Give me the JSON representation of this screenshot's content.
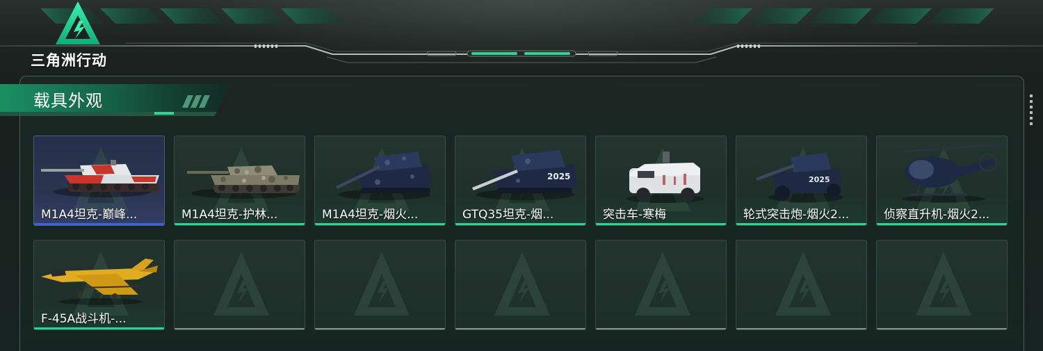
{
  "app": {
    "logo_text": "三角洲行动",
    "accent_color": "#2fd495",
    "selected_color": "#3a64e0"
  },
  "section": {
    "title": "载具外观"
  },
  "items": [
    {
      "label": "M1A4坦克-巅峰...",
      "kind": "tank-red",
      "state": "selected"
    },
    {
      "label": "M1A4坦克-护林...",
      "kind": "tank-camo",
      "state": "owned"
    },
    {
      "label": "M1A4坦克-烟火...",
      "kind": "tank-navy",
      "state": "owned"
    },
    {
      "label": "GTQ35坦克-烟...",
      "kind": "tank-navy-2025",
      "state": "owned"
    },
    {
      "label": "突击车-寒梅",
      "kind": "assault-vehicle",
      "state": "owned"
    },
    {
      "label": "轮式突击炮-烟火2...",
      "kind": "wheeled-gun",
      "state": "owned"
    },
    {
      "label": "侦察直升机-烟火2...",
      "kind": "helicopter",
      "state": "owned"
    },
    {
      "label": "F-45A战斗机-...",
      "kind": "fighter-jet",
      "state": "owned"
    },
    {
      "label": "",
      "kind": "empty",
      "state": "empty"
    },
    {
      "label": "",
      "kind": "empty",
      "state": "empty"
    },
    {
      "label": "",
      "kind": "empty",
      "state": "empty"
    },
    {
      "label": "",
      "kind": "empty",
      "state": "empty"
    },
    {
      "label": "",
      "kind": "empty",
      "state": "empty"
    },
    {
      "label": "",
      "kind": "empty",
      "state": "empty"
    }
  ]
}
